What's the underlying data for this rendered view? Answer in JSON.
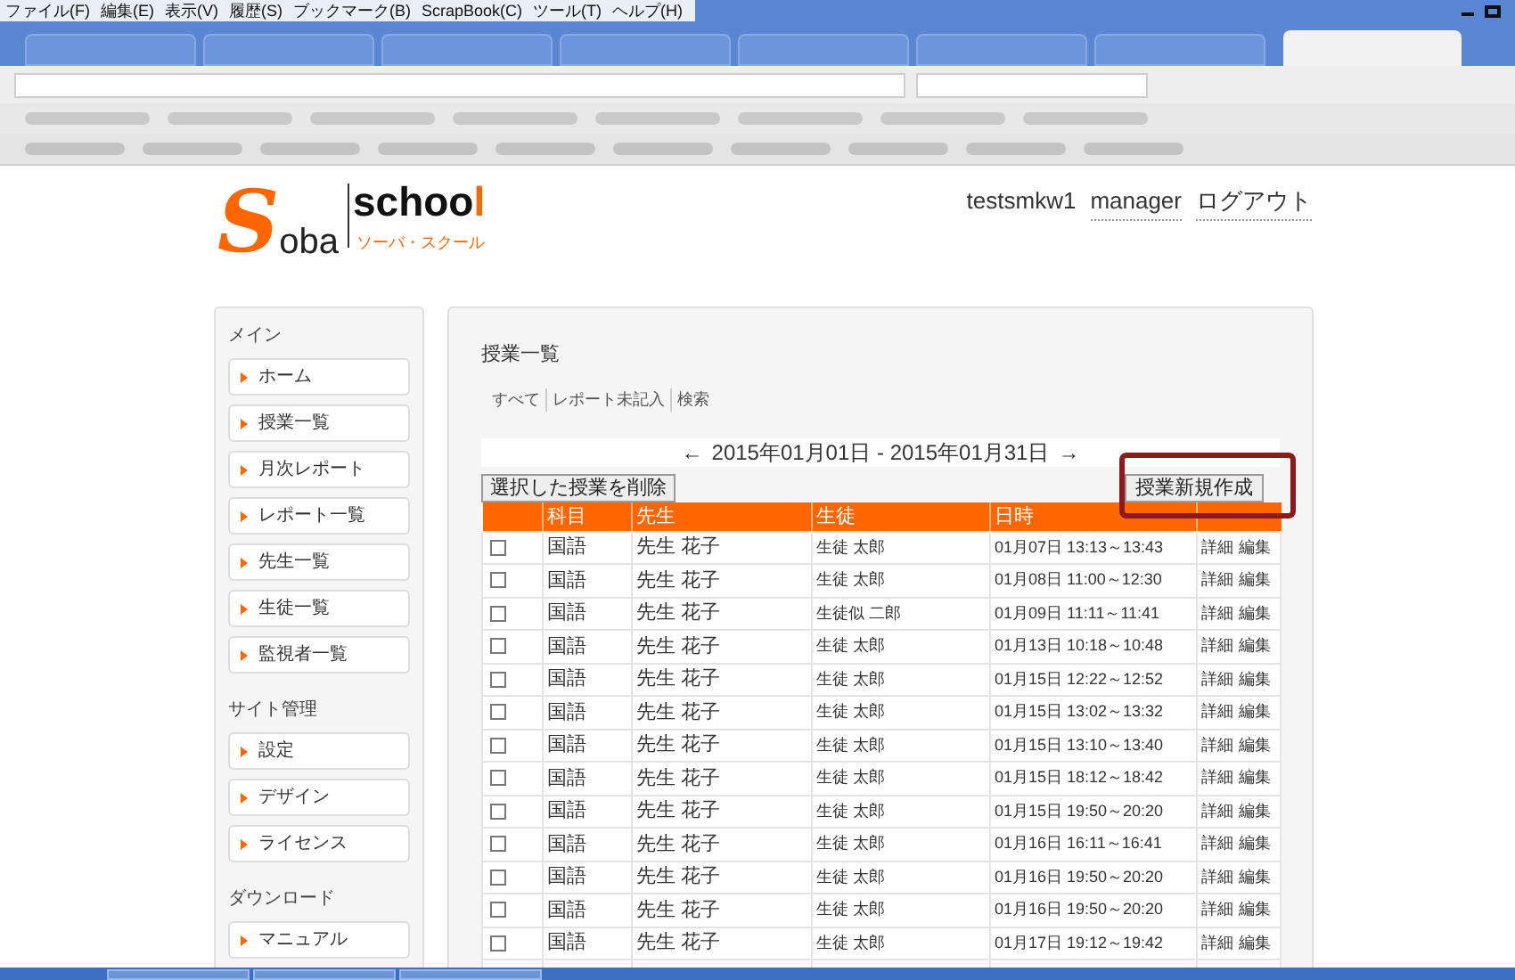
{
  "menu_bar": [
    "ファイル(F)",
    "編集(E)",
    "表示(V)",
    "履歴(S)",
    "ブックマーク(B)",
    "ScrapBook(C)",
    "ツール(T)",
    "ヘルプ(H)"
  ],
  "browser_tabs": [
    {
      "selected": false
    },
    {
      "selected": false
    },
    {
      "selected": false
    },
    {
      "selected": false
    },
    {
      "selected": false
    },
    {
      "selected": false
    },
    {
      "selected": false
    },
    {
      "selected": true
    }
  ],
  "logo": {
    "letters": [
      {
        "text": "S",
        "color": "#ff6600"
      },
      {
        "text": "oba",
        "color": "#222222"
      }
    ],
    "wordmark": [
      {
        "text": "schoo",
        "color": "#111111"
      },
      {
        "text": "l",
        "color": "#ff6600"
      }
    ],
    "tagline": "ソーバ・スクール"
  },
  "header": {
    "user": "testsmkw1",
    "links": [
      "manager",
      "ログアウト"
    ]
  },
  "sidebar": [
    {
      "title": "メイン",
      "items": [
        "ホーム",
        "授業一覧",
        "月次レポート",
        "レポート一覧",
        "先生一覧",
        "生徒一覧",
        "監視者一覧"
      ]
    },
    {
      "title": "サイト管理",
      "items": [
        "設定",
        "デザイン",
        "ライセンス"
      ]
    },
    {
      "title": "ダウンロード",
      "items": [
        "マニュアル"
      ]
    }
  ],
  "main": {
    "title": "授業一覧",
    "filters": [
      "すべて",
      "レポート未記入",
      "検索"
    ],
    "date_nav": {
      "prev": "←",
      "range": "2015年01月01日 - 2015年01月31日",
      "next": "→"
    },
    "delete_button": "選択した授業を削除",
    "new_button": "授業新規作成",
    "table": {
      "columns": [
        "",
        "科目",
        "先生",
        "生徒",
        "日時",
        ""
      ],
      "rows": [
        {
          "checked": false,
          "subject": "国語",
          "teacher": "先生 花子",
          "student": "生徒 太郎",
          "time": "01月07日 13:13～13:43",
          "actions": [
            "詳細",
            "編集"
          ]
        },
        {
          "checked": false,
          "subject": "国語",
          "teacher": "先生 花子",
          "student": "生徒 太郎",
          "time": "01月08日 11:00～12:30",
          "actions": [
            "詳細",
            "編集"
          ]
        },
        {
          "checked": false,
          "subject": "国語",
          "teacher": "先生 花子",
          "student": "生徒似 二郎",
          "time": "01月09日 11:11～11:41",
          "actions": [
            "詳細",
            "編集"
          ]
        },
        {
          "checked": false,
          "subject": "国語",
          "teacher": "先生 花子",
          "student": "生徒 太郎",
          "time": "01月13日 10:18～10:48",
          "actions": [
            "詳細",
            "編集"
          ]
        },
        {
          "checked": false,
          "subject": "国語",
          "teacher": "先生 花子",
          "student": "生徒 太郎",
          "time": "01月15日 12:22～12:52",
          "actions": [
            "詳細",
            "編集"
          ]
        },
        {
          "checked": false,
          "subject": "国語",
          "teacher": "先生 花子",
          "student": "生徒 太郎",
          "time": "01月15日 13:02～13:32",
          "actions": [
            "詳細",
            "編集"
          ]
        },
        {
          "checked": false,
          "subject": "国語",
          "teacher": "先生 花子",
          "student": "生徒 太郎",
          "time": "01月15日 13:10～13:40",
          "actions": [
            "詳細",
            "編集"
          ]
        },
        {
          "checked": false,
          "subject": "国語",
          "teacher": "先生 花子",
          "student": "生徒 太郎",
          "time": "01月15日 18:12～18:42",
          "actions": [
            "詳細",
            "編集"
          ]
        },
        {
          "checked": false,
          "subject": "国語",
          "teacher": "先生 花子",
          "student": "生徒 太郎",
          "time": "01月15日 19:50～20:20",
          "actions": [
            "詳細",
            "編集"
          ]
        },
        {
          "checked": false,
          "subject": "国語",
          "teacher": "先生 花子",
          "student": "生徒 太郎",
          "time": "01月16日 16:11～16:41",
          "actions": [
            "詳細",
            "編集"
          ]
        },
        {
          "checked": false,
          "subject": "国語",
          "teacher": "先生 花子",
          "student": "生徒 太郎",
          "time": "01月16日 19:50～20:20",
          "actions": [
            "詳細",
            "編集"
          ]
        },
        {
          "checked": false,
          "subject": "国語",
          "teacher": "先生 花子",
          "student": "生徒 太郎",
          "time": "01月16日 19:50～20:20",
          "actions": [
            "詳細",
            "編集"
          ]
        },
        {
          "checked": false,
          "subject": "国語",
          "teacher": "先生 花子",
          "student": "生徒 太郎",
          "time": "01月17日 19:12～19:42",
          "actions": [
            "詳細",
            "編集"
          ]
        }
      ]
    }
  }
}
